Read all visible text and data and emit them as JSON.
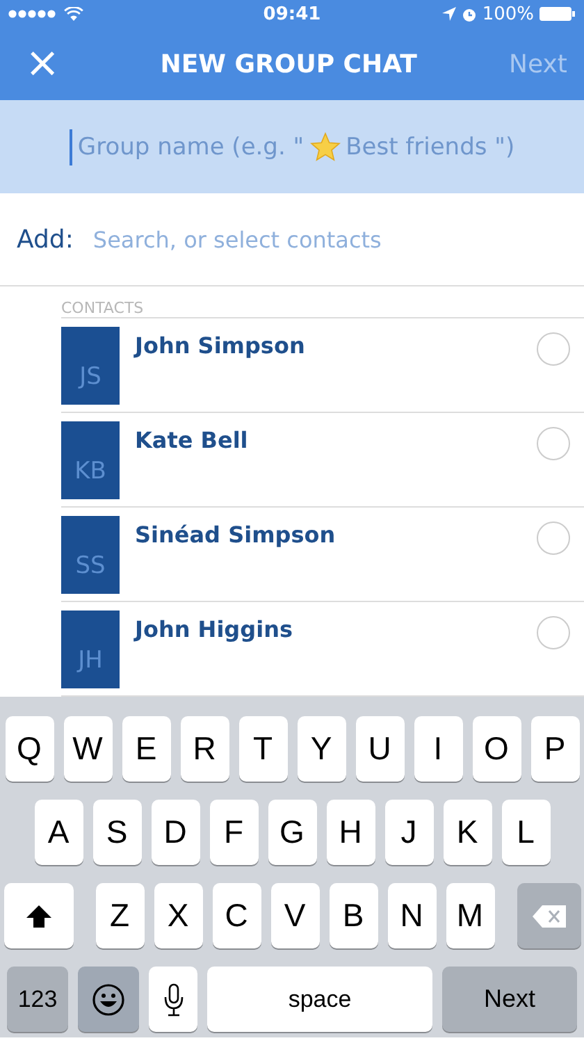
{
  "status_bar": {
    "time": "09:41",
    "battery": "100%"
  },
  "nav": {
    "close": "×",
    "title": "NEW GROUP CHAT",
    "next": {
      "label": "Next",
      "disabled": true
    }
  },
  "group_name": {
    "placeholder_start": "Group name (e.g. \"",
    "placeholder_end": "Best friends \")"
  },
  "add": {
    "label": "Add:",
    "placeholder": "Search, or select contacts"
  },
  "contacts": {
    "header": "CONTACTS",
    "items": [
      {
        "initials": "JS",
        "name": "John Simpson",
        "selected": false
      },
      {
        "initials": "KB",
        "name": "Kate Bell",
        "selected": false
      },
      {
        "initials": "SS",
        "name": "Sinéad Simpson",
        "selected": false
      },
      {
        "initials": "JH",
        "name": "John Higgins",
        "selected": false
      }
    ]
  },
  "keyboard": {
    "top_row": [
      {
        "kind": "letter",
        "label": "Q"
      },
      {
        "kind": "letter",
        "label": "W"
      },
      {
        "kind": "letter",
        "label": "E"
      },
      {
        "kind": "letter",
        "label": "R"
      },
      {
        "kind": "letter",
        "label": "T"
      },
      {
        "kind": "letter",
        "label": "Y"
      },
      {
        "kind": "letter",
        "label": "U"
      },
      {
        "kind": "letter",
        "label": "I"
      },
      {
        "kind": "letter",
        "label": "O"
      },
      {
        "kind": "letter",
        "label": "P"
      }
    ],
    "middle_row": [
      {
        "kind": "letter",
        "label": "A"
      },
      {
        "kind": "letter",
        "label": "S"
      },
      {
        "kind": "letter",
        "label": "D"
      },
      {
        "kind": "letter",
        "label": "F"
      },
      {
        "kind": "letter",
        "label": "G"
      },
      {
        "kind": "letter",
        "label": "H"
      },
      {
        "kind": "letter",
        "label": "J"
      },
      {
        "kind": "letter",
        "label": "K"
      },
      {
        "kind": "letter",
        "label": "L"
      }
    ],
    "bottom_row": [
      {
        "kind": "shift"
      },
      {
        "kind": "letter",
        "label": "Z"
      },
      {
        "kind": "letter",
        "label": "X"
      },
      {
        "kind": "letter",
        "label": "C"
      },
      {
        "kind": "letter",
        "label": "V"
      },
      {
        "kind": "letter",
        "label": "B"
      },
      {
        "kind": "letter",
        "label": "N"
      },
      {
        "kind": "letter",
        "label": "M"
      },
      {
        "kind": "delete"
      }
    ],
    "function_row": [
      {
        "kind": "mode",
        "label": "123"
      },
      {
        "kind": "emoji"
      },
      {
        "kind": "mic"
      },
      {
        "kind": "space",
        "label": "space"
      },
      {
        "kind": "return",
        "label": "Next"
      }
    ]
  }
}
